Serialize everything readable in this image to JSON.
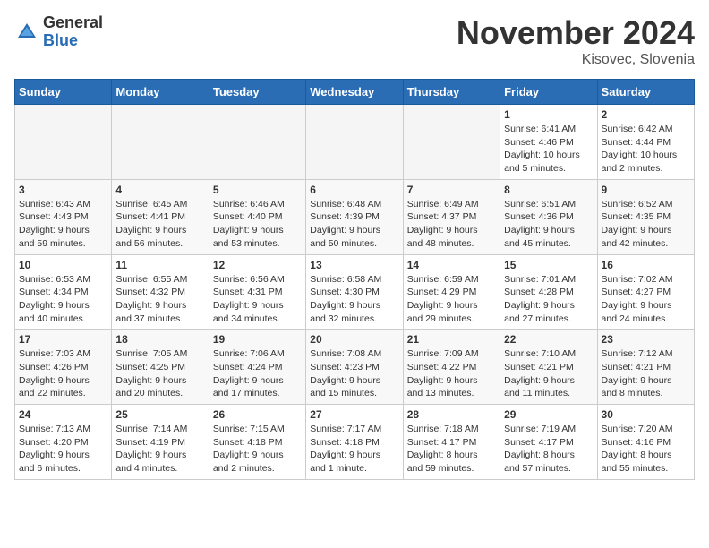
{
  "logo": {
    "general": "General",
    "blue": "Blue"
  },
  "title": "November 2024",
  "location": "Kisovec, Slovenia",
  "days_header": [
    "Sunday",
    "Monday",
    "Tuesday",
    "Wednesday",
    "Thursday",
    "Friday",
    "Saturday"
  ],
  "weeks": [
    [
      {
        "day": "",
        "info": ""
      },
      {
        "day": "",
        "info": ""
      },
      {
        "day": "",
        "info": ""
      },
      {
        "day": "",
        "info": ""
      },
      {
        "day": "",
        "info": ""
      },
      {
        "day": "1",
        "info": "Sunrise: 6:41 AM\nSunset: 4:46 PM\nDaylight: 10 hours\nand 5 minutes."
      },
      {
        "day": "2",
        "info": "Sunrise: 6:42 AM\nSunset: 4:44 PM\nDaylight: 10 hours\nand 2 minutes."
      }
    ],
    [
      {
        "day": "3",
        "info": "Sunrise: 6:43 AM\nSunset: 4:43 PM\nDaylight: 9 hours\nand 59 minutes."
      },
      {
        "day": "4",
        "info": "Sunrise: 6:45 AM\nSunset: 4:41 PM\nDaylight: 9 hours\nand 56 minutes."
      },
      {
        "day": "5",
        "info": "Sunrise: 6:46 AM\nSunset: 4:40 PM\nDaylight: 9 hours\nand 53 minutes."
      },
      {
        "day": "6",
        "info": "Sunrise: 6:48 AM\nSunset: 4:39 PM\nDaylight: 9 hours\nand 50 minutes."
      },
      {
        "day": "7",
        "info": "Sunrise: 6:49 AM\nSunset: 4:37 PM\nDaylight: 9 hours\nand 48 minutes."
      },
      {
        "day": "8",
        "info": "Sunrise: 6:51 AM\nSunset: 4:36 PM\nDaylight: 9 hours\nand 45 minutes."
      },
      {
        "day": "9",
        "info": "Sunrise: 6:52 AM\nSunset: 4:35 PM\nDaylight: 9 hours\nand 42 minutes."
      }
    ],
    [
      {
        "day": "10",
        "info": "Sunrise: 6:53 AM\nSunset: 4:34 PM\nDaylight: 9 hours\nand 40 minutes."
      },
      {
        "day": "11",
        "info": "Sunrise: 6:55 AM\nSunset: 4:32 PM\nDaylight: 9 hours\nand 37 minutes."
      },
      {
        "day": "12",
        "info": "Sunrise: 6:56 AM\nSunset: 4:31 PM\nDaylight: 9 hours\nand 34 minutes."
      },
      {
        "day": "13",
        "info": "Sunrise: 6:58 AM\nSunset: 4:30 PM\nDaylight: 9 hours\nand 32 minutes."
      },
      {
        "day": "14",
        "info": "Sunrise: 6:59 AM\nSunset: 4:29 PM\nDaylight: 9 hours\nand 29 minutes."
      },
      {
        "day": "15",
        "info": "Sunrise: 7:01 AM\nSunset: 4:28 PM\nDaylight: 9 hours\nand 27 minutes."
      },
      {
        "day": "16",
        "info": "Sunrise: 7:02 AM\nSunset: 4:27 PM\nDaylight: 9 hours\nand 24 minutes."
      }
    ],
    [
      {
        "day": "17",
        "info": "Sunrise: 7:03 AM\nSunset: 4:26 PM\nDaylight: 9 hours\nand 22 minutes."
      },
      {
        "day": "18",
        "info": "Sunrise: 7:05 AM\nSunset: 4:25 PM\nDaylight: 9 hours\nand 20 minutes."
      },
      {
        "day": "19",
        "info": "Sunrise: 7:06 AM\nSunset: 4:24 PM\nDaylight: 9 hours\nand 17 minutes."
      },
      {
        "day": "20",
        "info": "Sunrise: 7:08 AM\nSunset: 4:23 PM\nDaylight: 9 hours\nand 15 minutes."
      },
      {
        "day": "21",
        "info": "Sunrise: 7:09 AM\nSunset: 4:22 PM\nDaylight: 9 hours\nand 13 minutes."
      },
      {
        "day": "22",
        "info": "Sunrise: 7:10 AM\nSunset: 4:21 PM\nDaylight: 9 hours\nand 11 minutes."
      },
      {
        "day": "23",
        "info": "Sunrise: 7:12 AM\nSunset: 4:21 PM\nDaylight: 9 hours\nand 8 minutes."
      }
    ],
    [
      {
        "day": "24",
        "info": "Sunrise: 7:13 AM\nSunset: 4:20 PM\nDaylight: 9 hours\nand 6 minutes."
      },
      {
        "day": "25",
        "info": "Sunrise: 7:14 AM\nSunset: 4:19 PM\nDaylight: 9 hours\nand 4 minutes."
      },
      {
        "day": "26",
        "info": "Sunrise: 7:15 AM\nSunset: 4:18 PM\nDaylight: 9 hours\nand 2 minutes."
      },
      {
        "day": "27",
        "info": "Sunrise: 7:17 AM\nSunset: 4:18 PM\nDaylight: 9 hours\nand 1 minute."
      },
      {
        "day": "28",
        "info": "Sunrise: 7:18 AM\nSunset: 4:17 PM\nDaylight: 8 hours\nand 59 minutes."
      },
      {
        "day": "29",
        "info": "Sunrise: 7:19 AM\nSunset: 4:17 PM\nDaylight: 8 hours\nand 57 minutes."
      },
      {
        "day": "30",
        "info": "Sunrise: 7:20 AM\nSunset: 4:16 PM\nDaylight: 8 hours\nand 55 minutes."
      }
    ]
  ]
}
